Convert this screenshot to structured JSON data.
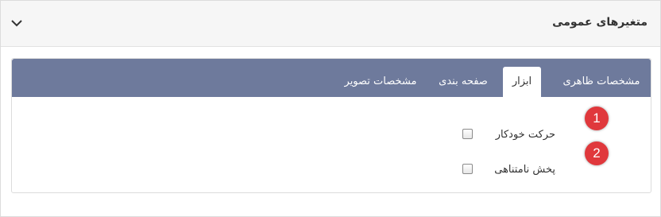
{
  "header": {
    "title": "متغیرهای عمومی",
    "collapse_icon": "chevron-down-icon"
  },
  "tabs": [
    {
      "label": "مشخصات ظاهری",
      "active": false
    },
    {
      "label": "ابزار",
      "active": true
    },
    {
      "label": "صفحه بندی",
      "active": false
    },
    {
      "label": "مشخصات تصویر",
      "active": false
    }
  ],
  "options": [
    {
      "label": "حرکت خودکار",
      "checked": false,
      "marker": "1"
    },
    {
      "label": "پخش نامتناهی",
      "checked": false,
      "marker": "2"
    }
  ],
  "colors": {
    "tab_bar": "#6e7a9c",
    "marker": "#e0383c"
  }
}
